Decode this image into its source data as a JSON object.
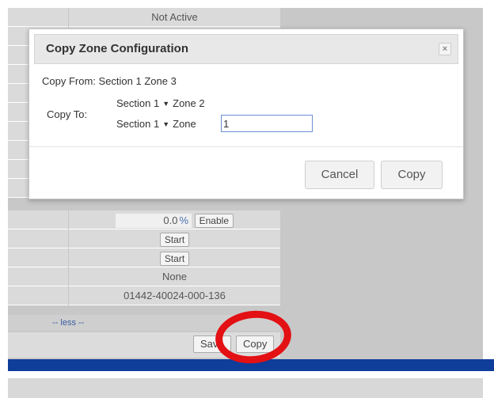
{
  "background": {
    "rows": [
      {
        "text": "Not Active",
        "kind": "text"
      },
      {
        "kind": "blank"
      },
      {
        "kind": "blank"
      },
      {
        "kind": "blank"
      },
      {
        "kind": "blank"
      },
      {
        "kind": "blank"
      },
      {
        "kind": "blank"
      },
      {
        "kind": "blank"
      },
      {
        "kind": "blank"
      },
      {
        "kind": "blank"
      }
    ],
    "percent_value": "0.0",
    "percent_symbol": "%",
    "enable_label": "Enable",
    "start_label_1": "Start",
    "start_label_2": "Start",
    "none_text": "None",
    "serial_text": "01442-40024-000-136",
    "less_link": "-- less --",
    "save_label": "Save",
    "copy_label": "Copy"
  },
  "dialog": {
    "title": "Copy Zone Configuration",
    "close_glyph": "×",
    "copy_from_label": "Copy From:",
    "copy_from_value": "Section 1 Zone 3",
    "copy_to_label": "Copy To:",
    "row1_section": "Section 1",
    "row1_zone": "Zone 2",
    "row2_section": "Section 1",
    "row2_zone_label": "Zone",
    "row2_zone_value": "1",
    "cancel_label": "Cancel",
    "copy_label": "Copy"
  },
  "colors": {
    "blue_band": "#0e3d9a",
    "highlight_ring": "#e31014"
  }
}
